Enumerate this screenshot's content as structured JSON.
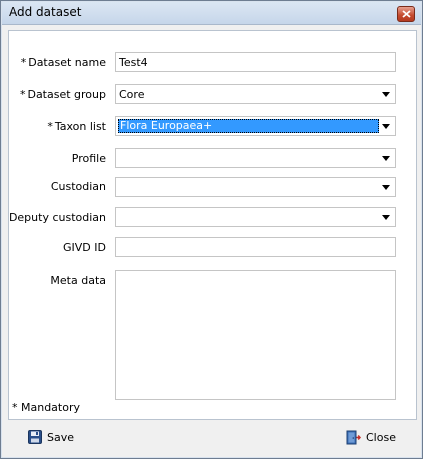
{
  "window": {
    "title": "Add dataset"
  },
  "form": {
    "fields": [
      {
        "label": "Dataset name",
        "required": true,
        "value": "Test4"
      },
      {
        "label": "Dataset group",
        "required": true,
        "value": "Core"
      },
      {
        "label": "Taxon list",
        "required": true,
        "value": "Flora Europaea+"
      },
      {
        "label": "Profile",
        "required": false,
        "value": ""
      },
      {
        "label": "Custodian",
        "required": false,
        "value": ""
      },
      {
        "label": "Deputy custodian",
        "required": false,
        "value": ""
      },
      {
        "label": "GIVD ID",
        "required": false,
        "value": ""
      },
      {
        "label": "Meta data",
        "required": false,
        "value": ""
      }
    ],
    "required_marker": "*",
    "mandatory_note": "Mandatory"
  },
  "footer": {
    "save_label": "Save",
    "close_label": "Close"
  },
  "icons": {
    "save": "floppy-disk-icon",
    "close": "close-door-icon"
  },
  "colors": {
    "selection": "#3399ff",
    "titlebar": "#c6d6ea"
  }
}
